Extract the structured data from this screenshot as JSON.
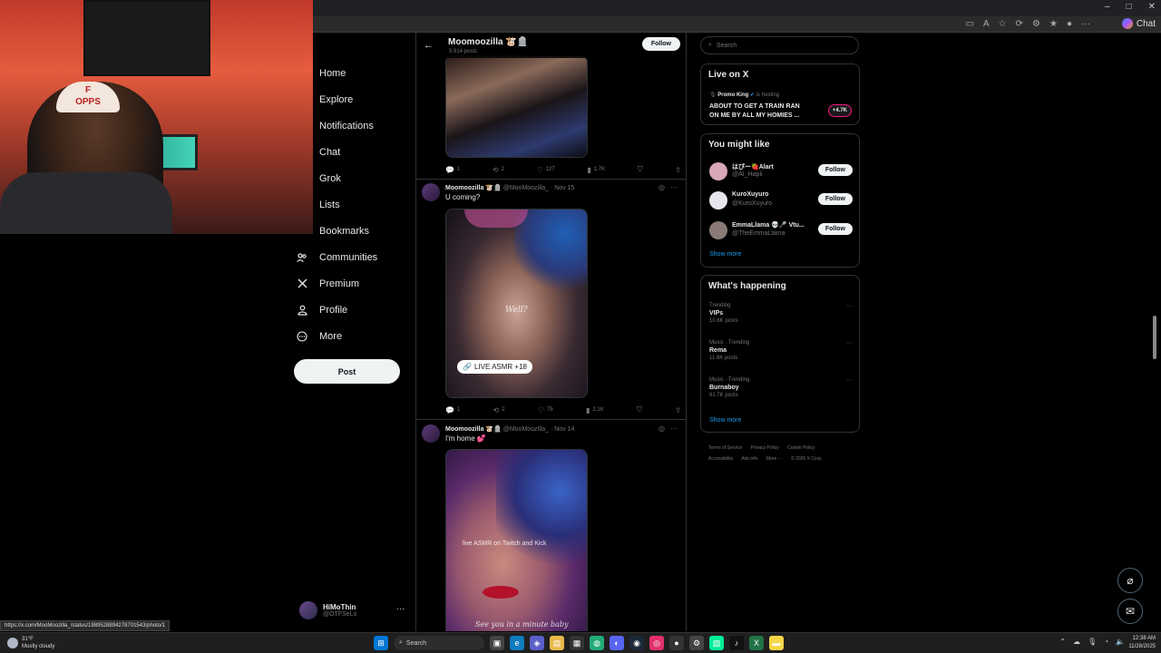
{
  "browser": {
    "window_controls": [
      "–",
      "□",
      "✕"
    ],
    "copilot_label": "Chat"
  },
  "nav": {
    "items": [
      {
        "label": "Home",
        "icon": "home-icon",
        "glyph": ""
      },
      {
        "label": "Explore",
        "icon": "search-icon",
        "glyph": ""
      },
      {
        "label": "Notifications",
        "icon": "bell-icon",
        "glyph": ""
      },
      {
        "label": "Chat",
        "icon": "chat-icon",
        "glyph": ""
      },
      {
        "label": "Grok",
        "icon": "grok-icon",
        "glyph": ""
      },
      {
        "label": "Lists",
        "icon": "list-icon",
        "glyph": ""
      },
      {
        "label": "Bookmarks",
        "icon": "bookmark-icon",
        "glyph": ""
      },
      {
        "label": "Communities",
        "icon": "people-icon",
        "glyph": "👥"
      },
      {
        "label": "Premium",
        "icon": "x-logo-icon",
        "glyph": "𝕏"
      },
      {
        "label": "Profile",
        "icon": "person-icon",
        "glyph": "👤"
      },
      {
        "label": "More",
        "icon": "more-circle-icon",
        "glyph": "⊙"
      }
    ],
    "post_label": "Post"
  },
  "account": {
    "name": "HiMoThin",
    "handle": "@OTFSeLo",
    "more": "···"
  },
  "profile_header": {
    "back": "←",
    "name": "Moomoozilla 🐮🪦",
    "posts": "5,914 posts",
    "follow_label": "Follow"
  },
  "tweets": [
    {
      "actions": {
        "replies": "1",
        "reposts": "2",
        "likes": "127",
        "views": "1.7K"
      }
    },
    {
      "author": "Moomoozilla 🐮🪦",
      "handle": "@MooMoozilla_",
      "date": "· Nov 15",
      "text": "U coming?",
      "watermark": "Well?",
      "badge": "LIVE ASMR +18",
      "actions": {
        "replies": "1",
        "reposts": "2",
        "likes": "75",
        "views": "2.1K"
      }
    },
    {
      "author": "Moomoozilla 🐮🪦",
      "handle": "@MooMoozilla_",
      "date": "· Nov 14",
      "text": "I'm home 💕",
      "overlay": "live ASMR on Twitch and Kick",
      "caption": "See you in a minute baby"
    }
  ],
  "sidebar": {
    "search_placeholder": "Search",
    "live": {
      "title": "Live on X",
      "host": "Promo King",
      "host_suffix": "is hosting",
      "stream_title": "ABOUT TO GET A TRAIN RAN ON ME BY ALL MY HOMIES ...",
      "count": "+4.7K"
    },
    "might_like": {
      "title": "You might like",
      "accounts": [
        {
          "name": "はぴー🍓Alart",
          "handle": "@AI_Hapii",
          "follow": "Follow"
        },
        {
          "name": "KuroXuyuro",
          "handle": "@KuroXuyuro",
          "follow": "Follow"
        },
        {
          "name": "EmmaLlama 💀🎤 Vtu...",
          "handle": "@TheEmmaLlama",
          "follow": "Follow"
        }
      ],
      "show_more": "Show more"
    },
    "happening": {
      "title": "What's happening",
      "trends": [
        {
          "context": "Trending",
          "name": "VIPs",
          "posts": "10.6K posts"
        },
        {
          "context": "Music · Trending",
          "name": "Rema",
          "posts": "11.6K posts"
        },
        {
          "context": "Music · Trending",
          "name": "Burnaboy",
          "posts": "91.7K posts"
        }
      ],
      "show_more": "Show more"
    },
    "footer": [
      "Terms of Service",
      "Privacy Policy",
      "Cookie Policy",
      "Accessibility",
      "Ads info",
      "More ···",
      "© 2025 X Corp."
    ]
  },
  "status_url": "https://x.com/MooMoozilla_/status/1989528894278701543/photo/1",
  "taskbar": {
    "temp": "31°F",
    "weather": "Mostly cloudy",
    "search": "Search",
    "time": "12:38 AM",
    "date": "11/28/2025"
  }
}
